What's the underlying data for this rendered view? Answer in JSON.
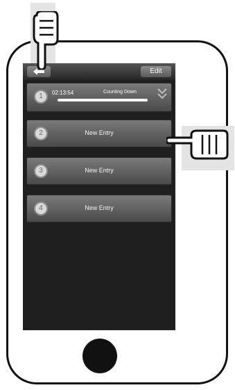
{
  "toolbar": {
    "back_icon": "back-arrow-icon",
    "edit_label": "Edit"
  },
  "timers": [
    {
      "number": "1",
      "time": "02:13:54",
      "status": "Counting Down",
      "progress": 1.0
    },
    {
      "number": "2",
      "label": "New Entry"
    },
    {
      "number": "3",
      "label": "New Entry"
    },
    {
      "number": "4",
      "label": "New Entry"
    }
  ],
  "colors": {
    "screen_bg": "#1f1f1f",
    "row_top": "#7a7a7a",
    "row_bottom": "#4a4a4a",
    "outline": "#111111"
  },
  "icons": [
    "pointing-hand-icon",
    "back-arrow-icon",
    "chevron-down-icon",
    "home-button"
  ]
}
